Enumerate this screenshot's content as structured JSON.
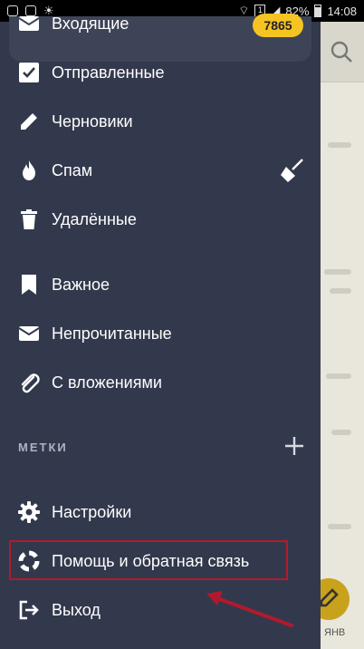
{
  "statusbar": {
    "battery": "82%",
    "time": "14:08",
    "sim": "1"
  },
  "drawer": {
    "items": [
      {
        "label": "Входящие",
        "icon": "inbox-icon",
        "badge": "7865"
      },
      {
        "label": "Отправленные",
        "icon": "sent-check-icon"
      },
      {
        "label": "Черновики",
        "icon": "pencil-icon"
      },
      {
        "label": "Спам",
        "icon": "flame-icon",
        "action_icon": "broom-icon"
      },
      {
        "label": "Удалённые",
        "icon": "trash-icon"
      },
      {
        "label": "Важное",
        "icon": "bookmark-icon"
      },
      {
        "label": "Непрочитанные",
        "icon": "envelope-icon"
      },
      {
        "label": "С вложениями",
        "icon": "paperclip-icon"
      }
    ],
    "labels_section": "МЕТКИ",
    "bottom": [
      {
        "label": "Настройки",
        "icon": "gear-icon"
      },
      {
        "label": "Помощь и обратная связь",
        "icon": "lifebuoy-icon"
      },
      {
        "label": "Выход",
        "icon": "logout-icon"
      }
    ]
  },
  "background": {
    "fab_label": "ЯНВ"
  },
  "colors": {
    "drawer_bg": "#33394c",
    "badge_bg": "#f5c322",
    "highlight": "#b21a2c"
  }
}
